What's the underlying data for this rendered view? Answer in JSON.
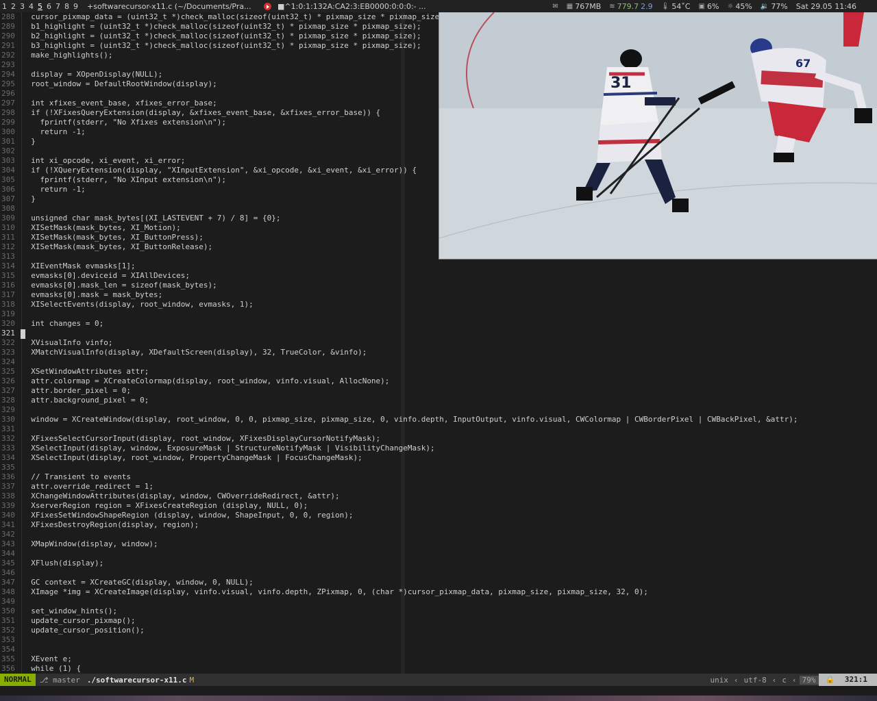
{
  "topbar": {
    "workspaces": [
      "1",
      "2",
      "3",
      "4",
      "5",
      "6",
      "7",
      "8",
      "9"
    ],
    "active_workspace": "5",
    "window_title": "+softwarecursor-x11.c (~/Documents/Pra...",
    "player_title": "■^1:0:1:132A:CA2:3:EB0000:0:0:0:- ...",
    "memory": "767MB",
    "net_down": "779.7",
    "net_up": "2.9",
    "temp": "54˚C",
    "cpu": "6%",
    "brightness": "45%",
    "volume": "77%",
    "datetime": "Sat 29.05 11:46"
  },
  "editor": {
    "lines": [
      {
        "n": "288",
        "t": "  cursor_pixmap_data = (uint32_t *)check_malloc(sizeof(uint32_t) * pixmap_size * pixmap_size);"
      },
      {
        "n": "289",
        "t": "  b1_highlight = (uint32_t *)check_malloc(sizeof(uint32_t) * pixmap_size * pixmap_size);"
      },
      {
        "n": "290",
        "t": "  b2_highlight = (uint32_t *)check_malloc(sizeof(uint32_t) * pixmap_size * pixmap_size);"
      },
      {
        "n": "291",
        "t": "  b3_highlight = (uint32_t *)check_malloc(sizeof(uint32_t) * pixmap_size * pixmap_size);"
      },
      {
        "n": "292",
        "t": "  make_highlights();"
      },
      {
        "n": "293",
        "t": ""
      },
      {
        "n": "294",
        "t": "  display = XOpenDisplay(NULL);"
      },
      {
        "n": "295",
        "t": "  root_window = DefaultRootWindow(display);"
      },
      {
        "n": "296",
        "t": ""
      },
      {
        "n": "297",
        "t": "  int xfixes_event_base, xfixes_error_base;"
      },
      {
        "n": "298",
        "t": "  if (!XFixesQueryExtension(display, &xfixes_event_base, &xfixes_error_base)) {"
      },
      {
        "n": "299",
        "t": "    fprintf(stderr, \"No Xfixes extension\\n\");"
      },
      {
        "n": "300",
        "t": "    return -1;"
      },
      {
        "n": "301",
        "t": "  }"
      },
      {
        "n": "302",
        "t": ""
      },
      {
        "n": "303",
        "t": "  int xi_opcode, xi_event, xi_error;"
      },
      {
        "n": "304",
        "t": "  if (!XQueryExtension(display, \"XInputExtension\", &xi_opcode, &xi_event, &xi_error)) {"
      },
      {
        "n": "305",
        "t": "    fprintf(stderr, \"No XInput extension\\n\");"
      },
      {
        "n": "306",
        "t": "    return -1;"
      },
      {
        "n": "307",
        "t": "  }"
      },
      {
        "n": "308",
        "t": ""
      },
      {
        "n": "309",
        "t": "  unsigned char mask_bytes[(XI_LASTEVENT + 7) / 8] = {0};"
      },
      {
        "n": "310",
        "t": "  XISetMask(mask_bytes, XI_Motion);"
      },
      {
        "n": "311",
        "t": "  XISetMask(mask_bytes, XI_ButtonPress);"
      },
      {
        "n": "312",
        "t": "  XISetMask(mask_bytes, XI_ButtonRelease);"
      },
      {
        "n": "313",
        "t": ""
      },
      {
        "n": "314",
        "t": "  XIEventMask evmasks[1];"
      },
      {
        "n": "315",
        "t": "  evmasks[0].deviceid = XIAllDevices;"
      },
      {
        "n": "316",
        "t": "  evmasks[0].mask_len = sizeof(mask_bytes);"
      },
      {
        "n": "317",
        "t": "  evmasks[0].mask = mask_bytes;"
      },
      {
        "n": "318",
        "t": "  XISelectEvents(display, root_window, evmasks, 1);"
      },
      {
        "n": "319",
        "t": ""
      },
      {
        "n": "320",
        "t": "  int changes = 0;"
      },
      {
        "n": "321",
        "t": ""
      },
      {
        "n": "322",
        "t": "  XVisualInfo vinfo;"
      },
      {
        "n": "323",
        "t": "  XMatchVisualInfo(display, XDefaultScreen(display), 32, TrueColor, &vinfo);"
      },
      {
        "n": "324",
        "t": ""
      },
      {
        "n": "325",
        "t": "  XSetWindowAttributes attr;"
      },
      {
        "n": "326",
        "t": "  attr.colormap = XCreateColormap(display, root_window, vinfo.visual, AllocNone);"
      },
      {
        "n": "327",
        "t": "  attr.border_pixel = 0;"
      },
      {
        "n": "328",
        "t": "  attr.background_pixel = 0;"
      },
      {
        "n": "329",
        "t": ""
      },
      {
        "n": "330",
        "t": "  window = XCreateWindow(display, root_window, 0, 0, pixmap_size, pixmap_size, 0, vinfo.depth, InputOutput, vinfo.visual, CWColormap | CWBorderPixel | CWBackPixel, &attr);"
      },
      {
        "n": "331",
        "t": ""
      },
      {
        "n": "332",
        "t": "  XFixesSelectCursorInput(display, root_window, XFixesDisplayCursorNotifyMask);"
      },
      {
        "n": "333",
        "t": "  XSelectInput(display, window, ExposureMask | StructureNotifyMask | VisibilityChangeMask);"
      },
      {
        "n": "334",
        "t": "  XSelectInput(display, root_window, PropertyChangeMask | FocusChangeMask);"
      },
      {
        "n": "335",
        "t": ""
      },
      {
        "n": "336",
        "t": "  // Transient to events"
      },
      {
        "n": "337",
        "t": "  attr.override_redirect = 1;"
      },
      {
        "n": "338",
        "t": "  XChangeWindowAttributes(display, window, CWOverrideRedirect, &attr);"
      },
      {
        "n": "339",
        "t": "  XserverRegion region = XFixesCreateRegion (display, NULL, 0);"
      },
      {
        "n": "340",
        "t": "  XFixesSetWindowShapeRegion (display, window, ShapeInput, 0, 0, region);"
      },
      {
        "n": "341",
        "t": "  XFixesDestroyRegion(display, region);"
      },
      {
        "n": "342",
        "t": ""
      },
      {
        "n": "343",
        "t": "  XMapWindow(display, window);"
      },
      {
        "n": "344",
        "t": ""
      },
      {
        "n": "345",
        "t": "  XFlush(display);"
      },
      {
        "n": "346",
        "t": ""
      },
      {
        "n": "347",
        "t": "  GC context = XCreateGC(display, window, 0, NULL);"
      },
      {
        "n": "348",
        "t": "  XImage *img = XCreateImage(display, vinfo.visual, vinfo.depth, ZPixmap, 0, (char *)cursor_pixmap_data, pixmap_size, pixmap_size, 32, 0);"
      },
      {
        "n": "349",
        "t": ""
      },
      {
        "n": "350",
        "t": "  set_window_hints();"
      },
      {
        "n": "351",
        "t": "  update_cursor_pixmap();"
      },
      {
        "n": "352",
        "t": "  update_cursor_position();"
      },
      {
        "n": "353",
        "t": ""
      },
      {
        "n": "354",
        "t": ""
      },
      {
        "n": "355",
        "t": "  XEvent e;"
      },
      {
        "n": "356",
        "t": "  while (1) {"
      }
    ],
    "cursor_line": "321"
  },
  "statusline": {
    "mode": "NORMAL",
    "branch": "master",
    "filename": "./softwarecursor-x11.c",
    "modified": "M",
    "fileformat": "unix",
    "encoding": "utf-8",
    "filetype": "c",
    "percent": "79%",
    "position": "321:1"
  },
  "overlay": {
    "player_number_left": "31",
    "player_number_right": "67"
  },
  "colors": {
    "mode_bg": "#87af00",
    "keyword": "#d7d787",
    "type": "#5fafff",
    "constant": "#d7875f"
  },
  "icons": [
    "mail-icon",
    "memory-icon",
    "wifi-icon",
    "temperature-icon",
    "cpu-icon",
    "brightness-icon",
    "volume-icon",
    "branch-icon",
    "lock-icon",
    "play-icon"
  ]
}
